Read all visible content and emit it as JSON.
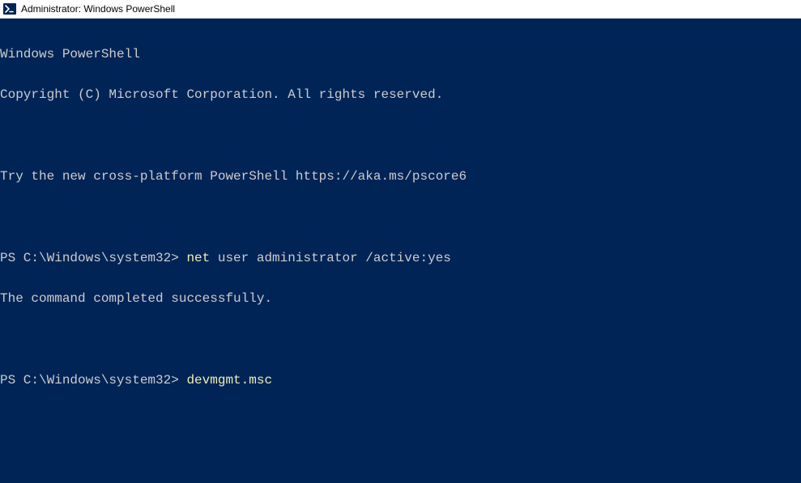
{
  "window": {
    "title": "Administrator: Windows PowerShell"
  },
  "terminal": {
    "banner_line1": "Windows PowerShell",
    "banner_line2": "Copyright (C) Microsoft Corporation. All rights reserved.",
    "banner_line3": "Try the new cross-platform PowerShell https://aka.ms/pscore6",
    "prompt1_prefix": "PS C:\\Windows\\system32> ",
    "prompt1_cmd_head": "net ",
    "prompt1_cmd_rest": "user administrator /active:yes",
    "result1": "The command completed successfully.",
    "prompt2_prefix": "PS C:\\Windows\\system32> ",
    "prompt2_cmd": "devmgmt.msc"
  },
  "colors": {
    "background": "#012456",
    "foreground": "#cccccc",
    "command": "#eeedb3",
    "titlebar_bg": "#ffffff",
    "titlebar_fg": "#000000"
  }
}
